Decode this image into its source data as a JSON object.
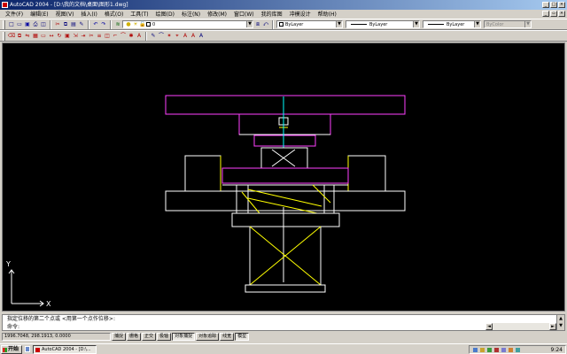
{
  "titlebar": {
    "title": "AutoCAD 2004 - [D:\\我的文档\\桌面\\图形1.dwg]"
  },
  "menubar": {
    "items": [
      "文件(F)",
      "编辑(E)",
      "视图(V)",
      "插入(I)",
      "格式(O)",
      "工具(T)",
      "绘图(D)",
      "标注(N)",
      "修改(M)",
      "窗口(W)",
      "我的库图",
      "冲模设计",
      "帮助(H)"
    ]
  },
  "toolbar": {
    "layer_value": "0",
    "color_value": "ByLayer",
    "linetype_value": "ByLayer",
    "lineweight_value": "ByLayer",
    "plotstyle_value": "ByColor",
    "modify_glyphs": [
      "⌫",
      "⧉",
      "⇋",
      "▦",
      "▭",
      "↔",
      "↻",
      "▣",
      "⇲",
      "⇥",
      "✂",
      "≡",
      "◫",
      "⌐",
      "⌒",
      "✱",
      "A"
    ],
    "dim_glyphs": [
      "✎",
      "⌒",
      "✶",
      "⌖",
      "A",
      "A",
      "A"
    ]
  },
  "ucs": {
    "x_label": "X",
    "y_label": "Y"
  },
  "command": {
    "line1": "指定位移的第二个点或 <用第一个点作位移>:",
    "line2": "命令:"
  },
  "status": {
    "coords": "1996.7048,  298.1913,  0.0000",
    "buttons": [
      "捕捉",
      "栅格",
      "正交",
      "极轴",
      "对象捕捉",
      "对象追踪",
      "线宽",
      "模型"
    ],
    "on_buttons": [
      "对象捕捉",
      "模型"
    ]
  },
  "taskbar": {
    "start_label": "开始",
    "task_label": "AutoCAD 2004 - [D:\\...",
    "clock": "9:24"
  },
  "colors": {
    "canvas_bg": "#000000",
    "drawing_magenta": "#ff40ff",
    "drawing_white": "#ffffff",
    "drawing_yellow": "#ffff00",
    "drawing_cyan": "#00ffff",
    "titlebar_start": "#0a246a"
  }
}
